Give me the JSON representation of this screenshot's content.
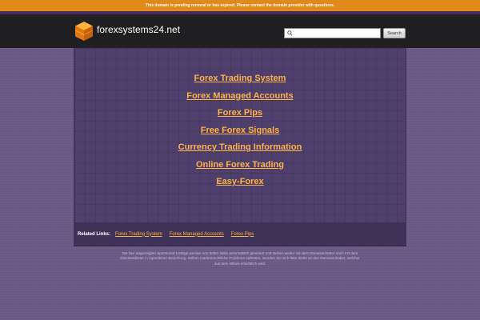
{
  "notice": "This domain is pending renewal or has expired. Please contact the domain provider with questions.",
  "header": {
    "site_name": "forexsystems24.net",
    "logo_icon": "orange-box-icon",
    "search_placeholder": "",
    "search_button": "Search"
  },
  "main_links": [
    "Forex Trading System",
    "Forex Managed Accounts",
    "Forex Pips",
    "Free Forex Signals",
    "Currency Trading Information",
    "Online Forex Trading",
    "Easy-Forex"
  ],
  "related": {
    "label": "Related Links:",
    "links": [
      "Forex Trading System",
      "Forex Managed Accounts",
      "Forex Pips"
    ]
  },
  "disclaimer": "Die hier angezeigten Sponsored Listings werden von dritter Seite automatisch generiert und stehen weder mit dem Domaininhaber noch mit dem Dienstanbieter in irgendeiner Beziehung. Sollten markenrechtliche Probleme auftreten, wenden Sie sich bitte direkt an den Domaininhaber, welcher aus dem Whois ersichtlich wird.",
  "colors": {
    "notice_bg": "#e08a1a",
    "header_bg": "#1d1d1f",
    "page_bg": "#6a5a86",
    "panel_bg": "#4e3f6c",
    "link": "#ffb347"
  }
}
